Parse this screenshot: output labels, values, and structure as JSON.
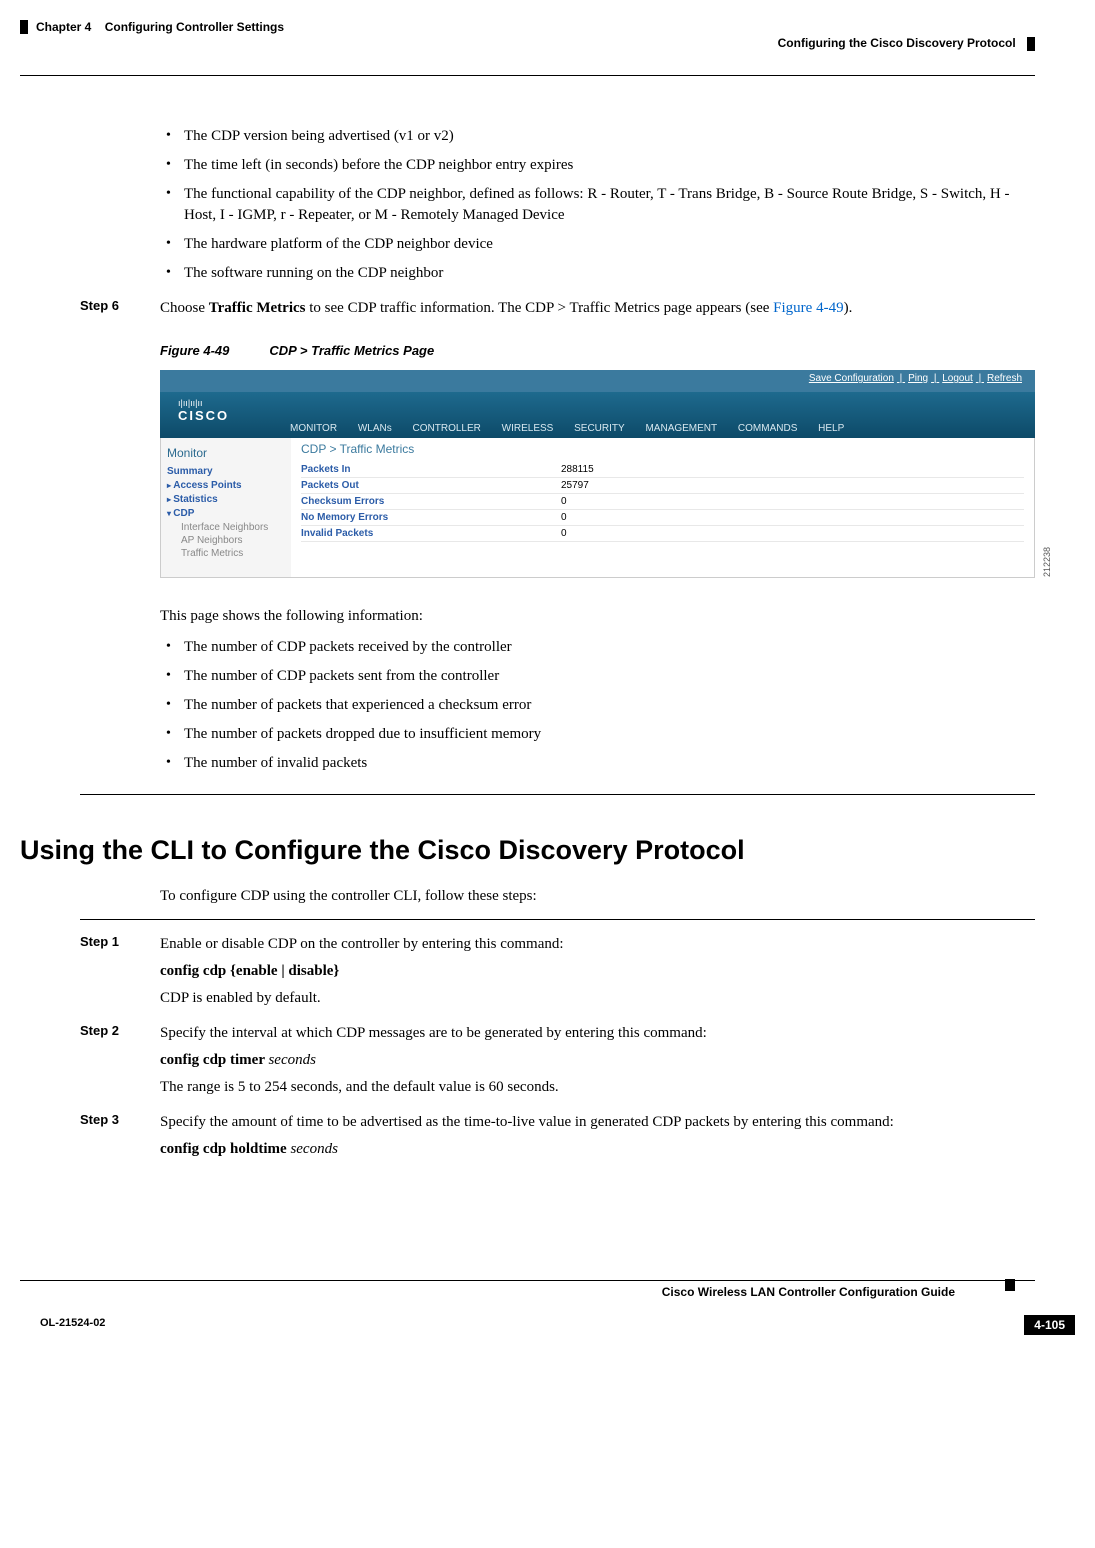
{
  "header": {
    "chapter_label": "Chapter 4",
    "chapter_title": "Configuring Controller Settings",
    "section_title": "Configuring the Cisco Discovery Protocol"
  },
  "bullets_top": [
    "The CDP version being advertised (v1 or v2)",
    "The time left (in seconds) before the CDP neighbor entry expires",
    "The functional capability of the CDP neighbor, defined as follows: R - Router, T - Trans Bridge, B - Source Route Bridge, S - Switch, H - Host, I - IGMP, r - Repeater, or M - Remotely Managed Device",
    "The hardware platform of the CDP neighbor device",
    "The software running on the CDP neighbor"
  ],
  "step6": {
    "label": "Step 6",
    "text_pre": "Choose ",
    "text_bold": "Traffic Metrics",
    "text_mid": " to see CDP traffic information. The CDP > Traffic Metrics page appears (see ",
    "link": "Figure 4-49",
    "text_post": ")."
  },
  "figure": {
    "label": "Figure 4-49",
    "title": "CDP > Traffic Metrics Page",
    "image_num": "212238"
  },
  "screenshot": {
    "toplinks": [
      "Save Configuration",
      "Ping",
      "Logout",
      "Refresh"
    ],
    "logo_bars": "ı|ıı|ıı|ıı",
    "logo_text": "CISCO",
    "nav": [
      "MONITOR",
      "WLANs",
      "CONTROLLER",
      "WIRELESS",
      "SECURITY",
      "MANAGEMENT",
      "COMMANDS",
      "HELP"
    ],
    "sidebar_title": "Monitor",
    "sidebar": {
      "summary": "Summary",
      "access_points": "Access Points",
      "statistics": "Statistics",
      "cdp": "CDP",
      "subs": [
        "Interface Neighbors",
        "AP Neighbors",
        "Traffic Metrics"
      ]
    },
    "main_title": "CDP > Traffic Metrics",
    "rows": [
      {
        "label": "Packets In",
        "value": "288115"
      },
      {
        "label": "Packets Out",
        "value": "25797"
      },
      {
        "label": "Checksum Errors",
        "value": "0"
      },
      {
        "label": "No Memory Errors",
        "value": "0"
      },
      {
        "label": "Invalid Packets",
        "value": "0"
      }
    ]
  },
  "intro_after_fig": "This page shows the following information:",
  "bullets_after": [
    "The number of CDP packets received by the controller",
    "The number of CDP packets sent from the controller",
    "The number of packets that experienced a checksum error",
    "The number of packets dropped due to insufficient memory",
    "The number of invalid packets"
  ],
  "cli_section": {
    "title": "Using the CLI to Configure the Cisco Discovery Protocol",
    "intro": "To configure CDP using the controller CLI, follow these steps:"
  },
  "cli_steps": [
    {
      "label": "Step 1",
      "text": "Enable or disable CDP on the controller by entering this command:",
      "cmd_pre": "config cdp ",
      "cmd_braced": "{enable | disable}",
      "note": "CDP is enabled by default."
    },
    {
      "label": "Step 2",
      "text": "Specify the interval at which CDP messages are to be generated by entering this command:",
      "cmd_pre": "config cdp timer ",
      "cmd_var": "seconds",
      "note": "The range is 5 to 254 seconds, and the default value is 60 seconds."
    },
    {
      "label": "Step 3",
      "text": "Specify the amount of time to be advertised as the time-to-live value in generated CDP packets by entering this command:",
      "cmd_pre": "config cdp holdtime ",
      "cmd_var": "seconds",
      "note": ""
    }
  ],
  "footer": {
    "doc_title": "Cisco Wireless LAN Controller Configuration Guide",
    "ol": "OL-21524-02",
    "page": "4-105"
  }
}
